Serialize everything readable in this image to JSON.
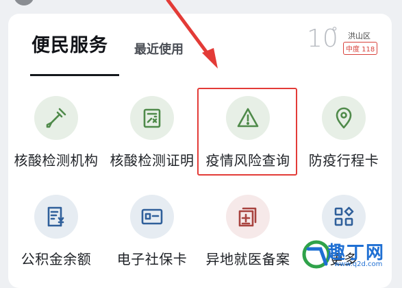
{
  "header": {
    "tab_active": "便民服务",
    "tab_recent": "最近使用"
  },
  "weather": {
    "temperature": "10",
    "unit": "°",
    "location": "洪山区",
    "aqi_label": "中度 118"
  },
  "services": [
    {
      "label": "核酸检测机构",
      "icon": "dropper-icon",
      "color": "#4f8a4a"
    },
    {
      "label": "核酸检测证明",
      "icon": "certificate-icon",
      "color": "#4f8a4a"
    },
    {
      "label": "疫情风险查询",
      "icon": "warning-icon",
      "color": "#4f8a4a"
    },
    {
      "label": "防疫行程卡",
      "icon": "location-pin-icon",
      "color": "#4f8a4a"
    },
    {
      "label": "公积金余额",
      "icon": "yuan-document-icon",
      "color": "#2f5f9a"
    },
    {
      "label": "电子社保卡",
      "icon": "id-card-icon",
      "color": "#2f5f9a"
    },
    {
      "label": "异地就医备案",
      "icon": "medical-record-icon",
      "color": "#a8433f"
    },
    {
      "label": "更多",
      "icon": "grid-more-icon",
      "color": "#2f5f9a"
    }
  ],
  "watermark": {
    "text": "趣丁网",
    "url": "www.q2d.com"
  }
}
